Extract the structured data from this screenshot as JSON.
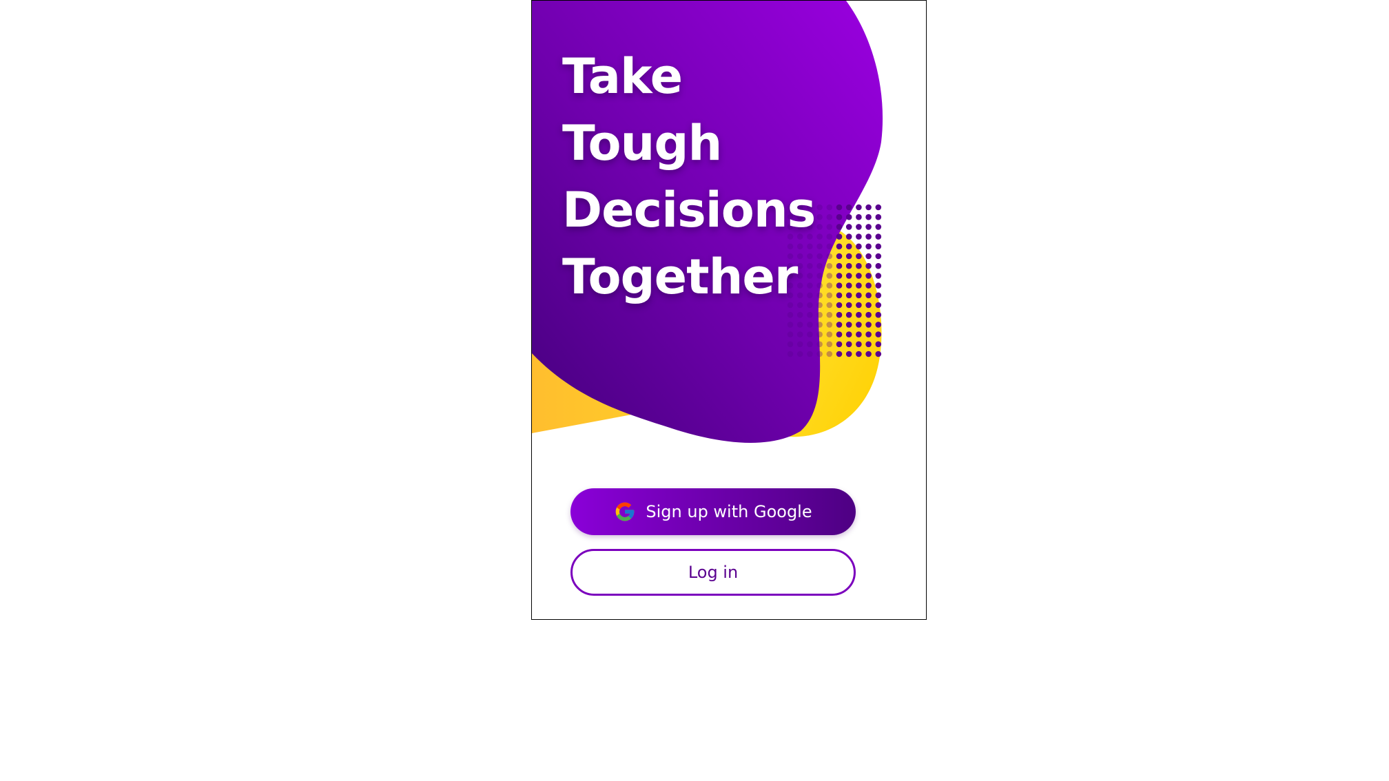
{
  "headline": {
    "line1": "Take",
    "line2": "Tough",
    "line3": "Decisions",
    "line4": "Together"
  },
  "actions": {
    "google_signup_label": "Sign up with Google",
    "login_label": "Log in"
  },
  "icons": {
    "google": "google-g-icon"
  },
  "colors": {
    "purple_light": "#9400d8",
    "purple_dark": "#4b0082",
    "yellow": "#ffd400",
    "orange_yellow": "#ffbf2e",
    "dot_purple": "#5a008f"
  }
}
